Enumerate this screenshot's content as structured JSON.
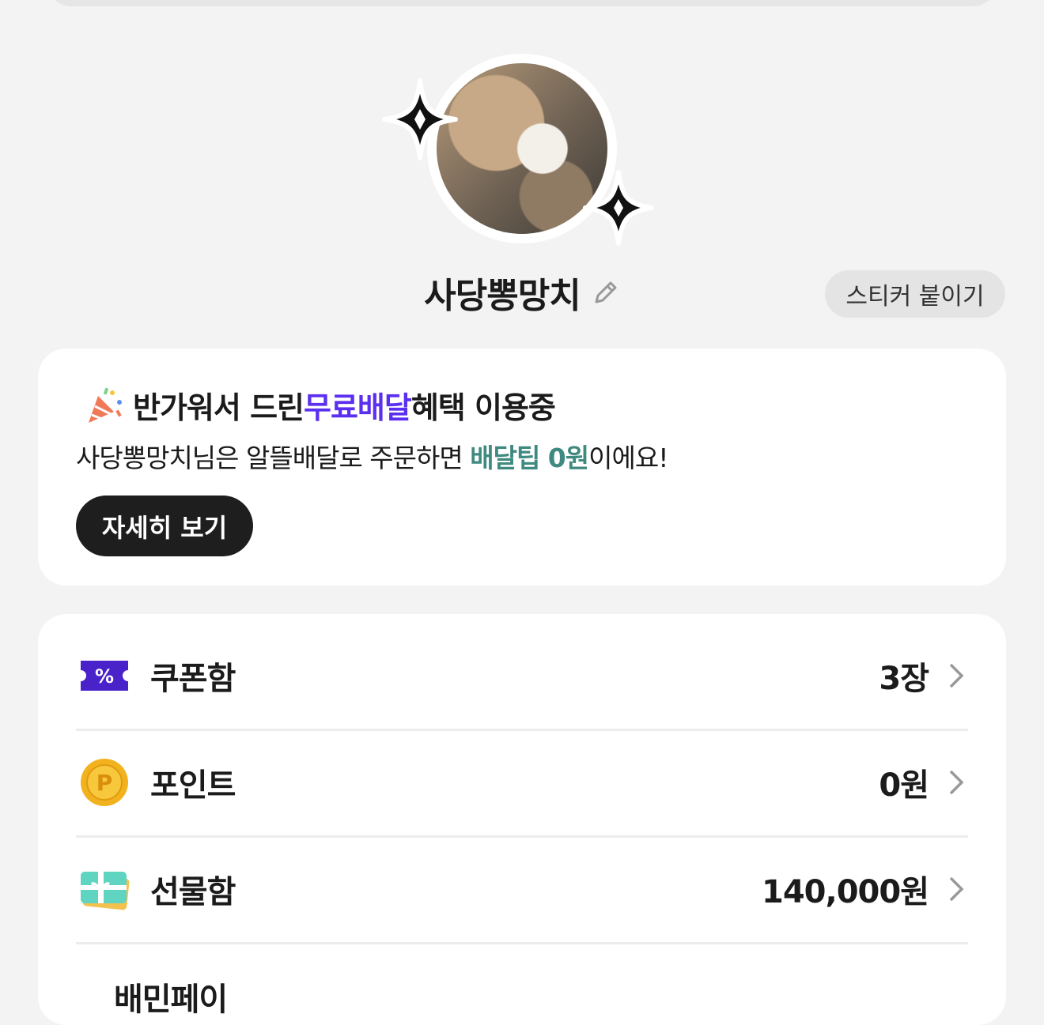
{
  "profile": {
    "nickname": "사당뽕망치",
    "sticker_button": "스티커 붙이기"
  },
  "promo": {
    "title_prefix": "반가워서 드린 ",
    "title_highlight": "무료배달",
    "title_suffix": " 혜택 이용중",
    "sub_prefix": "사당뽕망치님은 알뜰배달로 주문하면 ",
    "sub_highlight": "배달팁 0원",
    "sub_suffix": "이에요!",
    "detail_button": "자세히 보기"
  },
  "menu": [
    {
      "label": "쿠폰함",
      "value": "3장",
      "icon": "coupon-icon"
    },
    {
      "label": "포인트",
      "value": "0원",
      "icon": "point-coin-icon"
    },
    {
      "label": "선물함",
      "value": "140,000원",
      "icon": "gift-card-icon"
    },
    {
      "label": "배민페이",
      "value": "",
      "icon": "pay-icon"
    }
  ],
  "colors": {
    "highlight_purple": "#5b2ff0",
    "highlight_teal": "#3f8a80",
    "background": "#f3f3f3"
  }
}
